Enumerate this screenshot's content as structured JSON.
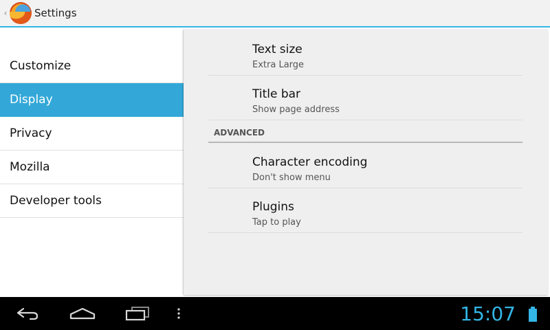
{
  "action_bar": {
    "title": "Settings",
    "up_caret": "‹"
  },
  "sidebar": {
    "items": [
      {
        "label": "Customize",
        "selected": false
      },
      {
        "label": "Display",
        "selected": true
      },
      {
        "label": "Privacy",
        "selected": false
      },
      {
        "label": "Mozilla",
        "selected": false
      },
      {
        "label": "Developer tools",
        "selected": false
      }
    ]
  },
  "display_prefs": {
    "text_size": {
      "title": "Text size",
      "summary": "Extra Large"
    },
    "title_bar": {
      "title": "Title bar",
      "summary": "Show page address"
    },
    "advanced_header": "ADVANCED",
    "character_encoding": {
      "title": "Character encoding",
      "summary": "Don't show menu"
    },
    "plugins": {
      "title": "Plugins",
      "summary": "Tap to play"
    }
  },
  "status": {
    "clock": "15:07"
  },
  "colors": {
    "accent": "#33b5e5",
    "selected_item": "#33a8d8"
  },
  "icons": {
    "app": "firefox-logo-icon",
    "back": "back-icon",
    "home": "home-icon",
    "recents": "recent-apps-icon",
    "menu": "overflow-menu-icon",
    "battery": "battery-icon"
  }
}
